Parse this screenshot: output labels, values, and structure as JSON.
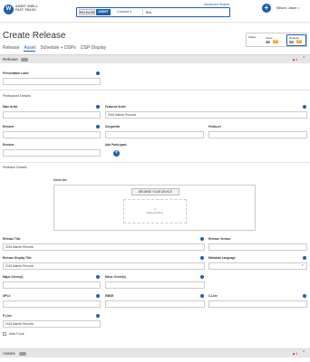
{
  "header": {
    "logo_letter": "W",
    "brand_line1": "ASSET SHELL",
    "brand_line2": "FAST TRACK",
    "advanced_search": "Advanced Search",
    "search_seg_release": "RELEASE",
    "search_seg_asset": "ASSET",
    "search_filter": "Contains",
    "search_value": "Bru",
    "user_name": "Wilsen, Jason"
  },
  "page": {
    "title": "Create Release",
    "tabs": [
      "Release",
      "Asset",
      "Schedule + DSPs",
      "DSP Display"
    ],
    "active_tab": "Asset"
  },
  "status_box": {
    "label": "Status",
    "asset_label": "Asset",
    "asset_count": "4/4",
    "release_label": "Release",
    "release_count": "4/4",
    "accent": "#f5a623"
  },
  "sections": {
    "release": "Release",
    "release_warn_count": "1",
    "assets": "Assets",
    "assets_warn_count": "1"
  },
  "fields": {
    "presentation_label": "Presentation Label",
    "participant_details": "Participant Details",
    "main_artist": "Main Artist",
    "featured_artist": "Featured Artist",
    "featured_artist_value": "2018 Atlantic Records",
    "remixer": "Remixer",
    "songwriter": "Songwriter",
    "producer": "Producer",
    "remixer2": "Remixer",
    "add_participant": "Add Participant",
    "release_details": "Release Details",
    "cover_art": "Cover Art",
    "browse_button": "BROWSE YOUR DEVICE",
    "drop_or": "or",
    "drop_text": "Drag and Drop",
    "release_title": "Release Title",
    "release_title_value": "2018 Atlantic Records",
    "release_version": "Release Version",
    "release_display_title": "Release Display Title",
    "release_display_title_value": "2018 Atlantic Records",
    "metadata_language": "Metadata Language",
    "major_genre": "Major Genre(s)",
    "minor_genre": "Minor Genre(s)",
    "upc": "UPC#",
    "wbse": "WBSE",
    "c_line": "C-Line",
    "p_line": "P-Line",
    "p_line_value": "2018 Atlantic Records",
    "hide_p_line": "Hide P-Line"
  },
  "colors": {
    "brand": "#1b5fae",
    "warning": "#d0021b",
    "section_bar": "#e6e6e6"
  }
}
